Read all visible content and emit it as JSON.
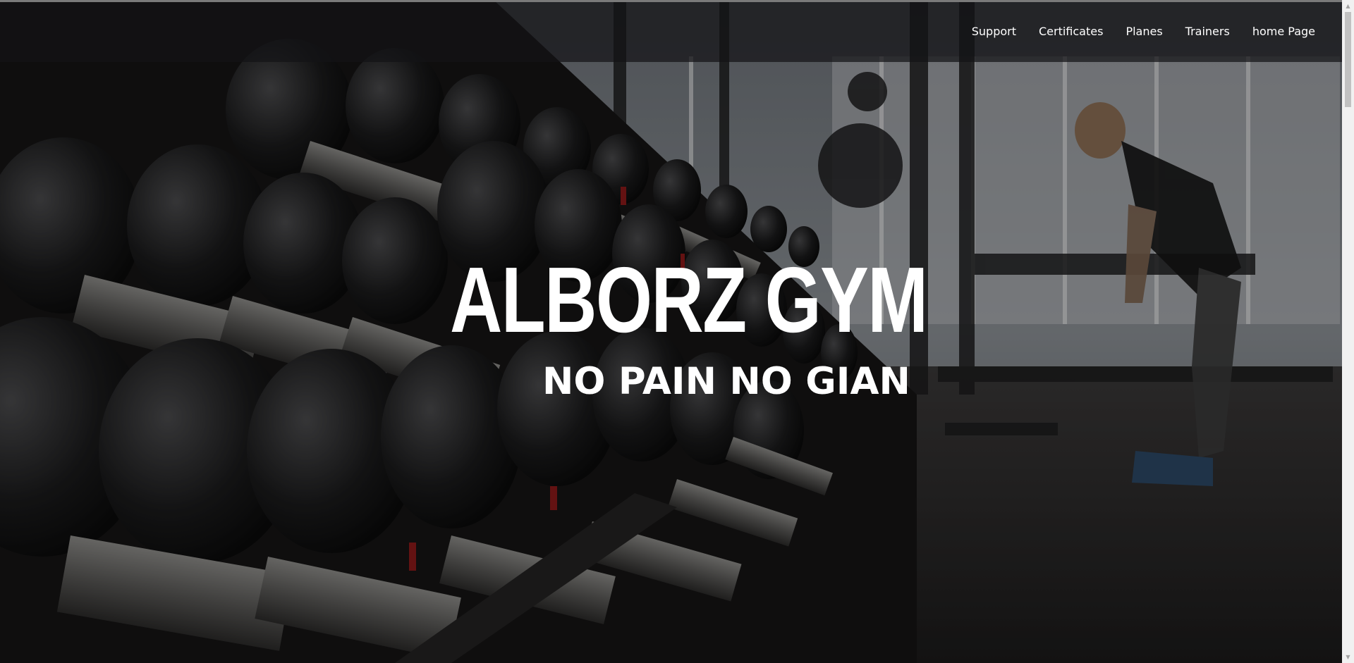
{
  "site": {
    "brand": "ALBORZ GYM",
    "slogan": "NO PAIN NO GIAN"
  },
  "nav": {
    "items": [
      {
        "label": "Support"
      },
      {
        "label": "Certificates"
      },
      {
        "label": "Planes"
      },
      {
        "label": "Trainers"
      },
      {
        "label": "home Page"
      }
    ]
  },
  "hero": {
    "image": "gym-dumbbell-rack-photo"
  },
  "colors": {
    "text": "#ffffff",
    "navbar": "#141416",
    "scrollbar_track": "#f1f1f1",
    "scrollbar_thumb": "#c1c1c1"
  },
  "scrollbar": {
    "up_icon": "triangle-up-icon",
    "down_icon": "triangle-down-icon",
    "up_glyph": "▲",
    "down_glyph": "▼"
  }
}
